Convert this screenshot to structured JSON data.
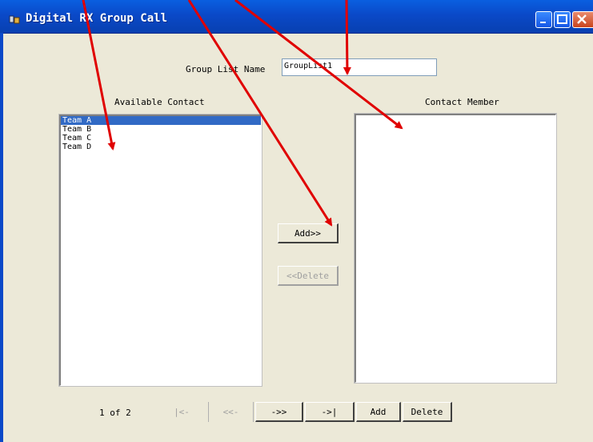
{
  "window": {
    "title": "Digital RX Group Call",
    "minimize_label": "",
    "maximize_label": "",
    "close_label": ""
  },
  "form": {
    "group_list_name_label": "Group List Name",
    "group_list_name_value": "GroupList1"
  },
  "available": {
    "header": "Available Contact",
    "items": [
      "Team A",
      "Team B",
      "Team C",
      "Team D"
    ],
    "selected_index": 0
  },
  "members": {
    "header": "Contact Member",
    "items": []
  },
  "actions": {
    "add_label": "Add>>",
    "delete_label": "<<Delete"
  },
  "navigation": {
    "page_indicator": "1 of 2",
    "first_label": "|<-",
    "prev_label": "<<-",
    "next_label": "->>",
    "last_label": "->|",
    "add_label": "Add",
    "delete_label": "Delete"
  },
  "colors": {
    "annotation_arrow": "#e00000",
    "selection": "#316ac5",
    "titlebar": "#0a49c8"
  }
}
